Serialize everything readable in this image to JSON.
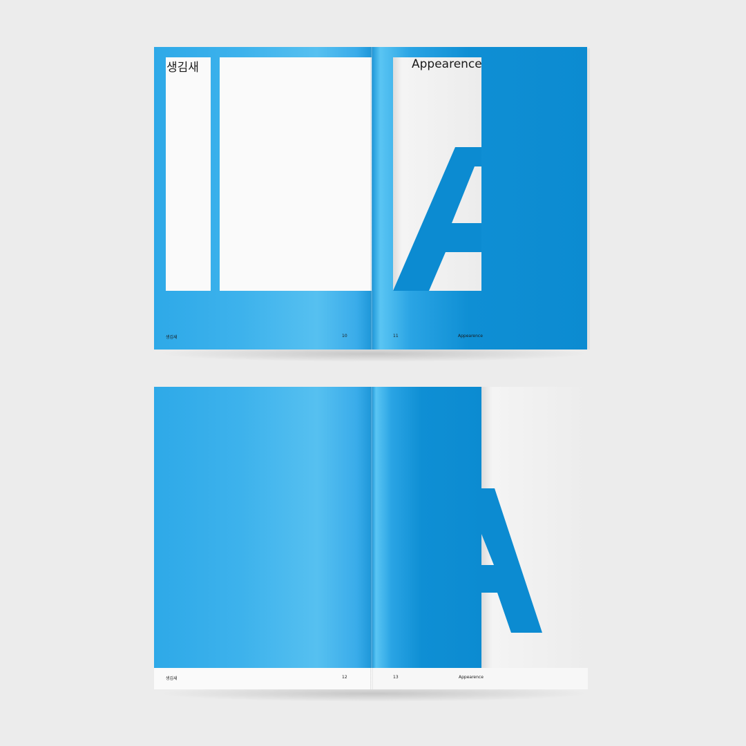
{
  "top_spread": {
    "left_title": "생김새",
    "right_title": "Appearence",
    "left_footer_title": "생김새",
    "left_page_number": "10",
    "right_page_number": "11",
    "right_footer_title": "Appearence"
  },
  "bottom_spread": {
    "left_footer_title": "생김새",
    "left_page_number": "12",
    "right_page_number": "13",
    "right_footer_title": "Appearence"
  },
  "colors": {
    "accent_blue": "#0c8bd1",
    "paper_white": "#fafafa",
    "background": "#ececec"
  }
}
